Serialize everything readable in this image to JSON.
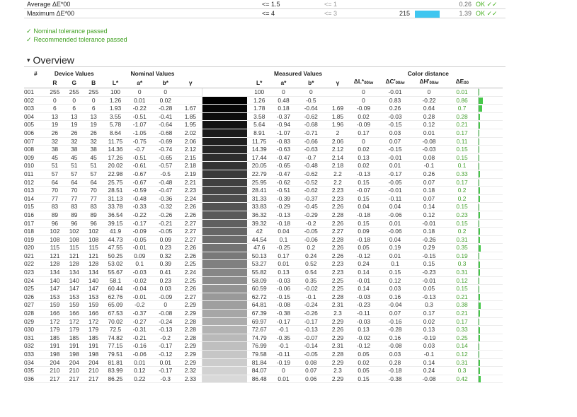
{
  "summary": {
    "rows": [
      {
        "label": "Average ΔE*00",
        "nominal": "<= 1.5",
        "recommended": "<= 1",
        "count": "",
        "bar": 0,
        "value": "0.26",
        "status": "OK ✓✓"
      },
      {
        "label": "Maximum ΔE*00",
        "nominal": "<= 4",
        "recommended": "<= 3",
        "count": "215",
        "bar": 0.55,
        "value": "1.39",
        "status": "OK ✓✓"
      }
    ]
  },
  "messages": [
    {
      "icon": "✓",
      "text": "Nominal tolerance passed"
    },
    {
      "icon": "✓",
      "text": "Recommended tolerance passed"
    }
  ],
  "section": {
    "title": "Overview",
    "icon": "▾"
  },
  "table": {
    "group_headers": {
      "index": "#",
      "device": "Device Values",
      "nominal": "Nominal Values",
      "measured": "Measured Values",
      "distance": "Color distance"
    },
    "col_headers": {
      "r": "R",
      "g": "G",
      "b": "B",
      "nl": "L*",
      "na": "a*",
      "nb": "b*",
      "ng": "γ",
      "ml": "L*",
      "ma": "a*",
      "mb": "b*",
      "mg": "γ",
      "dl": "ΔL*",
      "dl_sub": "00/w",
      "dc": "ΔC'",
      "dc_sub": "00/w",
      "dh": "ΔH'",
      "dh_sub": "00/w",
      "de": "ΔE",
      "de_sub": "00"
    },
    "rows": [
      [
        "001",
        "255",
        "255",
        "255",
        "100",
        "0",
        "0",
        "",
        "100",
        "0",
        "0",
        "",
        "0",
        "-0.01",
        "0",
        "0.01"
      ],
      [
        "002",
        "0",
        "0",
        "0",
        "1.26",
        "0.01",
        "0.02",
        "",
        "1.26",
        "0.48",
        "-0.5",
        "",
        "0",
        "0.83",
        "-0.22",
        "0.86"
      ],
      [
        "003",
        "6",
        "6",
        "6",
        "1.93",
        "-0.22",
        "-0.28",
        "1.67",
        "1.78",
        "0.18",
        "-0.64",
        "1.69",
        "-0.09",
        "0.26",
        "0.64",
        "0.7"
      ],
      [
        "004",
        "13",
        "13",
        "13",
        "3.55",
        "-0.51",
        "-0.41",
        "1.85",
        "3.58",
        "-0.37",
        "-0.62",
        "1.85",
        "0.02",
        "-0.03",
        "0.28",
        "0.28"
      ],
      [
        "005",
        "19",
        "19",
        "19",
        "5.78",
        "-1.07",
        "-0.64",
        "1.95",
        "5.64",
        "-0.94",
        "-0.68",
        "1.96",
        "-0.09",
        "-0.15",
        "0.12",
        "0.21"
      ],
      [
        "006",
        "26",
        "26",
        "26",
        "8.64",
        "-1.05",
        "-0.68",
        "2.02",
        "8.91",
        "-1.07",
        "-0.71",
        "2",
        "0.17",
        "0.03",
        "0.01",
        "0.17"
      ],
      [
        "007",
        "32",
        "32",
        "32",
        "11.75",
        "-0.75",
        "-0.69",
        "2.06",
        "11.75",
        "-0.83",
        "-0.66",
        "2.06",
        "0",
        "0.07",
        "-0.08",
        "0.11"
      ],
      [
        "008",
        "38",
        "38",
        "38",
        "14.36",
        "-0.7",
        "-0.74",
        "2.12",
        "14.39",
        "-0.63",
        "-0.63",
        "2.12",
        "0.02",
        "-0.15",
        "-0.03",
        "0.15"
      ],
      [
        "009",
        "45",
        "45",
        "45",
        "17.26",
        "-0.51",
        "-0.65",
        "2.15",
        "17.44",
        "-0.47",
        "-0.7",
        "2.14",
        "0.13",
        "-0.01",
        "0.08",
        "0.15"
      ],
      [
        "010",
        "51",
        "51",
        "51",
        "20.02",
        "-0.61",
        "-0.57",
        "2.18",
        "20.05",
        "-0.65",
        "-0.48",
        "2.18",
        "0.02",
        "0.01",
        "-0.1",
        "0.1"
      ],
      [
        "011",
        "57",
        "57",
        "57",
        "22.98",
        "-0.67",
        "-0.5",
        "2.19",
        "22.79",
        "-0.47",
        "-0.62",
        "2.2",
        "-0.13",
        "-0.17",
        "0.26",
        "0.33"
      ],
      [
        "012",
        "64",
        "64",
        "64",
        "25.75",
        "-0.67",
        "-0.48",
        "2.21",
        "25.95",
        "-0.62",
        "-0.52",
        "2.2",
        "0.15",
        "-0.05",
        "0.07",
        "0.17"
      ],
      [
        "013",
        "70",
        "70",
        "70",
        "28.51",
        "-0.59",
        "-0.47",
        "2.23",
        "28.41",
        "-0.51",
        "-0.62",
        "2.23",
        "-0.07",
        "-0.01",
        "0.18",
        "0.2"
      ],
      [
        "014",
        "77",
        "77",
        "77",
        "31.13",
        "-0.48",
        "-0.36",
        "2.24",
        "31.33",
        "-0.39",
        "-0.37",
        "2.23",
        "0.15",
        "-0.11",
        "0.07",
        "0.2"
      ],
      [
        "015",
        "83",
        "83",
        "83",
        "33.78",
        "-0.33",
        "-0.32",
        "2.26",
        "33.83",
        "-0.29",
        "-0.45",
        "2.26",
        "0.04",
        "0.04",
        "0.14",
        "0.15"
      ],
      [
        "016",
        "89",
        "89",
        "89",
        "36.54",
        "-0.22",
        "-0.26",
        "2.26",
        "36.32",
        "-0.13",
        "-0.29",
        "2.28",
        "-0.18",
        "-0.06",
        "0.12",
        "0.23"
      ],
      [
        "017",
        "96",
        "96",
        "96",
        "39.15",
        "-0.17",
        "-0.21",
        "2.27",
        "39.32",
        "-0.18",
        "-0.2",
        "2.26",
        "0.15",
        "0.01",
        "-0.01",
        "0.15"
      ],
      [
        "018",
        "102",
        "102",
        "102",
        "41.9",
        "-0.09",
        "-0.05",
        "2.27",
        "42",
        "0.04",
        "-0.05",
        "2.27",
        "0.09",
        "-0.06",
        "0.18",
        "0.2"
      ],
      [
        "019",
        "108",
        "108",
        "108",
        "44.73",
        "-0.05",
        "0.09",
        "2.27",
        "44.54",
        "0.1",
        "-0.06",
        "2.28",
        "-0.18",
        "0.04",
        "-0.26",
        "0.31"
      ],
      [
        "020",
        "115",
        "115",
        "115",
        "47.55",
        "-0.01",
        "0.23",
        "2.26",
        "47.6",
        "-0.25",
        "0.2",
        "2.26",
        "0.05",
        "0.19",
        "0.29",
        "0.35"
      ],
      [
        "021",
        "121",
        "121",
        "121",
        "50.25",
        "0.09",
        "0.32",
        "2.26",
        "50.13",
        "0.17",
        "0.24",
        "2.26",
        "-0.12",
        "0.01",
        "-0.15",
        "0.19"
      ],
      [
        "022",
        "128",
        "128",
        "128",
        "53.02",
        "0.1",
        "0.39",
        "2.25",
        "53.27",
        "0.01",
        "0.52",
        "2.23",
        "0.24",
        "0.1",
        "0.15",
        "0.3"
      ],
      [
        "023",
        "134",
        "134",
        "134",
        "55.67",
        "-0.03",
        "0.41",
        "2.24",
        "55.82",
        "0.13",
        "0.54",
        "2.23",
        "0.14",
        "0.15",
        "-0.23",
        "0.31"
      ],
      [
        "024",
        "140",
        "140",
        "140",
        "58.1",
        "-0.02",
        "0.23",
        "2.25",
        "58.09",
        "-0.03",
        "0.35",
        "2.25",
        "-0.01",
        "0.12",
        "-0.01",
        "0.12"
      ],
      [
        "025",
        "147",
        "147",
        "147",
        "60.44",
        "-0.04",
        "0.03",
        "2.26",
        "60.59",
        "-0.06",
        "-0.02",
        "2.25",
        "0.14",
        "0.03",
        "0.05",
        "0.15"
      ],
      [
        "026",
        "153",
        "153",
        "153",
        "62.76",
        "-0.01",
        "-0.09",
        "2.27",
        "62.72",
        "-0.15",
        "-0.1",
        "2.28",
        "-0.03",
        "0.16",
        "-0.13",
        "0.21"
      ],
      [
        "027",
        "159",
        "159",
        "159",
        "65.09",
        "-0.2",
        "0",
        "2.29",
        "64.81",
        "-0.08",
        "-0.24",
        "2.31",
        "-0.23",
        "-0.04",
        "0.3",
        "0.38"
      ],
      [
        "028",
        "166",
        "166",
        "166",
        "67.53",
        "-0.37",
        "-0.08",
        "2.29",
        "67.39",
        "-0.38",
        "-0.26",
        "2.3",
        "-0.11",
        "0.07",
        "0.17",
        "0.21"
      ],
      [
        "029",
        "172",
        "172",
        "172",
        "70.02",
        "-0.27",
        "-0.24",
        "2.28",
        "69.97",
        "-0.17",
        "-0.17",
        "2.29",
        "-0.03",
        "-0.16",
        "0.02",
        "0.17"
      ],
      [
        "030",
        "179",
        "179",
        "179",
        "72.5",
        "-0.31",
        "-0.13",
        "2.28",
        "72.67",
        "-0.1",
        "-0.13",
        "2.26",
        "0.13",
        "-0.28",
        "0.13",
        "0.33"
      ],
      [
        "031",
        "185",
        "185",
        "185",
        "74.82",
        "-0.21",
        "-0.2",
        "2.28",
        "74.79",
        "-0.35",
        "-0.07",
        "2.29",
        "-0.02",
        "0.16",
        "-0.19",
        "0.25"
      ],
      [
        "032",
        "191",
        "191",
        "191",
        "77.15",
        "-0.16",
        "-0.17",
        "2.29",
        "76.99",
        "-0.1",
        "-0.14",
        "2.31",
        "-0.12",
        "-0.08",
        "0.03",
        "0.14"
      ],
      [
        "033",
        "198",
        "198",
        "198",
        "79.51",
        "-0.06",
        "-0.12",
        "2.29",
        "79.58",
        "-0.11",
        "-0.05",
        "2.28",
        "0.05",
        "0.03",
        "-0.1",
        "0.12"
      ],
      [
        "034",
        "204",
        "204",
        "204",
        "81.81",
        "0.01",
        "0.01",
        "2.29",
        "81.84",
        "-0.19",
        "0.08",
        "2.29",
        "0.02",
        "0.28",
        "0.14",
        "0.31"
      ],
      [
        "035",
        "210",
        "210",
        "210",
        "83.99",
        "0.12",
        "-0.17",
        "2.32",
        "84.07",
        "0",
        "0.07",
        "2.3",
        "0.05",
        "-0.18",
        "0.24",
        "0.3"
      ],
      [
        "036",
        "217",
        "217",
        "217",
        "86.25",
        "0.22",
        "-0.3",
        "2.33",
        "86.48",
        "0.01",
        "0.06",
        "2.29",
        "0.15",
        "-0.38",
        "-0.08",
        "0.42"
      ]
    ]
  }
}
